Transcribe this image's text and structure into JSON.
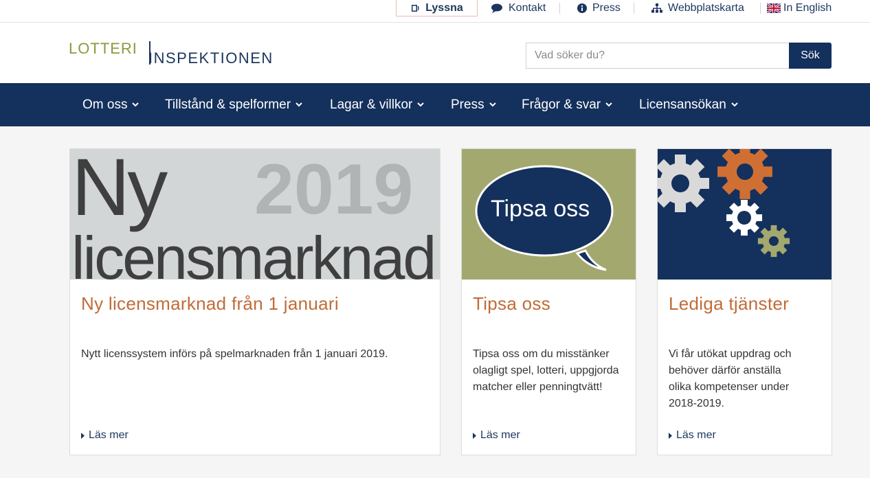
{
  "topbar": {
    "lyssna": "Lyssna",
    "kontakt": "Kontakt",
    "press": "Press",
    "webbplatskarta": "Webbplatskarta",
    "english": "In English"
  },
  "logo": {
    "part1": "LOTTERI",
    "part2": "INSPEKTIONEN"
  },
  "search": {
    "placeholder": "Vad söker du?",
    "button": "Sök"
  },
  "nav": {
    "items": [
      "Om oss",
      "Tillstånd & spelformer",
      "Lagar & villkor",
      "Press",
      "Frågor & svar",
      "Licensansökan"
    ]
  },
  "colors": {
    "navy": "#14305c",
    "accent_orange": "#c06c38",
    "olive": "#a3a86f",
    "logo_green": "#8a9a3a"
  },
  "cards": [
    {
      "image_text_big": "Ny",
      "image_text_year": "2019",
      "image_text_word": "licensmarknad",
      "title": "Ny licensmarknad från 1 januari",
      "text": "Nytt licenssystem införs på spelmarknaden från 1 januari 2019.",
      "more": "Läs mer"
    },
    {
      "image_text": "Tipsa oss",
      "title": "Tipsa oss",
      "text": "Tipsa oss om du misstänker olagligt spel, lotteri, uppgjorda matcher eller penningtvätt!",
      "more": "Läs mer"
    },
    {
      "title": "Lediga tjänster",
      "text": "Vi får utökat uppdrag och behöver därför anställa olika kompetenser under 2018-2019.",
      "more": "Läs mer"
    }
  ]
}
